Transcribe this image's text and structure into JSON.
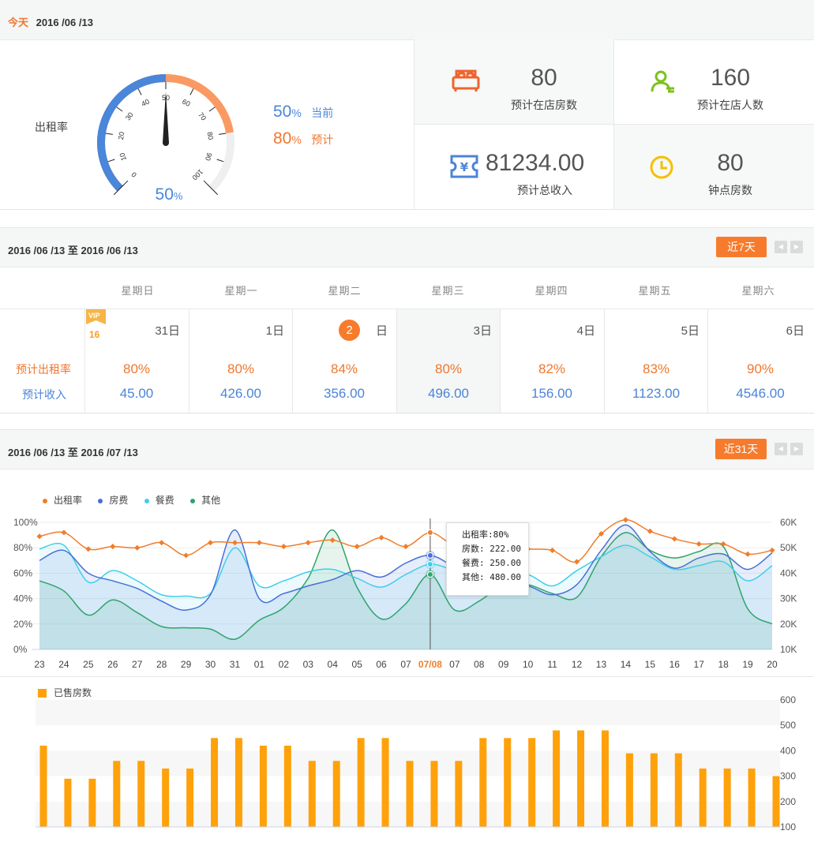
{
  "header": {
    "today_label": "今天",
    "date": "2016 /06 /13"
  },
  "occupancy": {
    "label": "出租率",
    "gauge_value": "50",
    "gauge_unit": "%",
    "gauge_ticks": [
      "0",
      "10",
      "20",
      "30",
      "40",
      "50",
      "60",
      "70",
      "80",
      "90",
      "100"
    ],
    "current_value": "50",
    "current_unit": "%",
    "current_label": "当前",
    "forecast_value": "80",
    "forecast_unit": "%",
    "forecast_label": "预计",
    "current_fraction": 0.5,
    "forecast_fraction": 0.8,
    "colors": {
      "current": "#4a86d9",
      "forecast": "#f99a63",
      "rest": "#efefef"
    }
  },
  "stats": [
    {
      "value": "80",
      "label": "预计在店房数",
      "icon": "bed-icon",
      "color": "#f0632d"
    },
    {
      "value": "160",
      "label": "预计在店人数",
      "icon": "person-icon",
      "color": "#7cc21a"
    },
    {
      "value": "81234.00",
      "label": "预计总收入",
      "icon": "yuan-ticket-icon",
      "color": "#4b84d8"
    },
    {
      "value": "80",
      "label": "钟点房数",
      "icon": "clock-icon",
      "color": "#f5c000"
    }
  ],
  "week": {
    "range": "2016 /06 /13 至 2016 /06 /13",
    "button": "近7天",
    "prev": "◀",
    "next": "▶",
    "row_rate_label": "预计出租率",
    "row_revenue_label": "预计收入",
    "weekdays": [
      "星期日",
      "星期一",
      "星期二",
      "星期三",
      "星期四",
      "星期五",
      "星期六"
    ],
    "vip_badge": "VIP",
    "vip_count": "16",
    "days": [
      {
        "day": "31日",
        "rate": "80%",
        "revenue": "45.00"
      },
      {
        "day": "1日",
        "rate": "80%",
        "revenue": "426.00"
      },
      {
        "day": "2",
        "day_suffix": "日",
        "rate": "84%",
        "revenue": "356.00",
        "today": true
      },
      {
        "day": "3日",
        "rate": "80%",
        "revenue": "496.00",
        "selected": true
      },
      {
        "day": "4日",
        "rate": "82%",
        "revenue": "156.00"
      },
      {
        "day": "5日",
        "rate": "83%",
        "revenue": "1123.00"
      },
      {
        "day": "6日",
        "rate": "90%",
        "revenue": "4546.00"
      }
    ]
  },
  "month": {
    "range": "2016 /06 /13 至 2016 /07 /13",
    "button": "近31天",
    "prev": "◀",
    "next": "▶"
  },
  "tooltip": {
    "rate": "出租率:80%",
    "room": "房数: 222.00",
    "food": "餐费: 250.00",
    "other": "其他: 480.00"
  },
  "chart_data": [
    {
      "type": "line",
      "categories": [
        "23",
        "24",
        "25",
        "26",
        "27",
        "28",
        "29",
        "30",
        "31",
        "01",
        "02",
        "03",
        "04",
        "05",
        "06",
        "07",
        "07/08",
        "07",
        "08",
        "09",
        "10",
        "11",
        "12",
        "13",
        "14",
        "15",
        "16",
        "17",
        "18",
        "19",
        "20"
      ],
      "highlight_index": 16,
      "y_left_ticks": [
        "100%",
        "80%",
        "60%",
        "40%",
        "20%",
        "0%"
      ],
      "y_right_ticks": [
        "60K",
        "50K",
        "40K",
        "30K",
        "20K",
        "10K"
      ],
      "ylim_left": [
        0,
        100
      ],
      "ylim_right": [
        10,
        60
      ],
      "legend_position": "top-left",
      "series": [
        {
          "name": "出租率",
          "axis": "left",
          "color": "#f07d2a",
          "values": [
            89,
            92,
            79,
            81,
            80,
            84,
            74,
            84,
            84,
            84,
            81,
            84,
            86,
            81,
            88,
            81,
            92,
            82,
            85,
            81,
            79,
            78,
            69,
            91,
            102,
            93,
            87,
            83,
            83,
            75,
            78
          ]
        },
        {
          "name": "房费",
          "axis": "left",
          "color": "#4670d6",
          "values": [
            70,
            78,
            60,
            54,
            48,
            38,
            31,
            43,
            94,
            40,
            44,
            50,
            55,
            62,
            57,
            68,
            74,
            65,
            58,
            52,
            50,
            43,
            51,
            78,
            98,
            77,
            64,
            72,
            75,
            63,
            76
          ]
        },
        {
          "name": "餐费",
          "axis": "left",
          "color": "#3fcfe8",
          "values": [
            79,
            82,
            53,
            62,
            54,
            43,
            42,
            44,
            80,
            50,
            54,
            61,
            63,
            56,
            49,
            59,
            67,
            62,
            57,
            60,
            59,
            50,
            62,
            73,
            82,
            73,
            63,
            66,
            69,
            54,
            66
          ]
        },
        {
          "name": "其他",
          "axis": "left",
          "color": "#2fa46c",
          "values": [
            54,
            46,
            27,
            39,
            29,
            18,
            17,
            16,
            8,
            23,
            33,
            56,
            94,
            49,
            24,
            36,
            59,
            31,
            38,
            51,
            51,
            44,
            41,
            73,
            92,
            78,
            72,
            77,
            81,
            32,
            20
          ]
        }
      ]
    },
    {
      "type": "bar",
      "categories": [
        "23",
        "24",
        "25",
        "26",
        "27",
        "28",
        "29",
        "30",
        "31",
        "01",
        "02",
        "03",
        "04",
        "05",
        "06",
        "07",
        "07/08",
        "07",
        "08",
        "09",
        "10",
        "11",
        "12",
        "13",
        "14",
        "15",
        "16",
        "17",
        "18",
        "19",
        "20"
      ],
      "series": [
        {
          "name": "已售房数",
          "color": "#ffa10a",
          "values": [
            420,
            290,
            290,
            360,
            360,
            330,
            330,
            450,
            450,
            420,
            420,
            360,
            360,
            450,
            450,
            360,
            360,
            360,
            450,
            450,
            450,
            480,
            480,
            480,
            390,
            390,
            390,
            330,
            330,
            330,
            300
          ]
        }
      ],
      "y_ticks": [
        "600",
        "500",
        "400",
        "300",
        "200",
        "100"
      ],
      "ylim": [
        100,
        600
      ]
    }
  ]
}
